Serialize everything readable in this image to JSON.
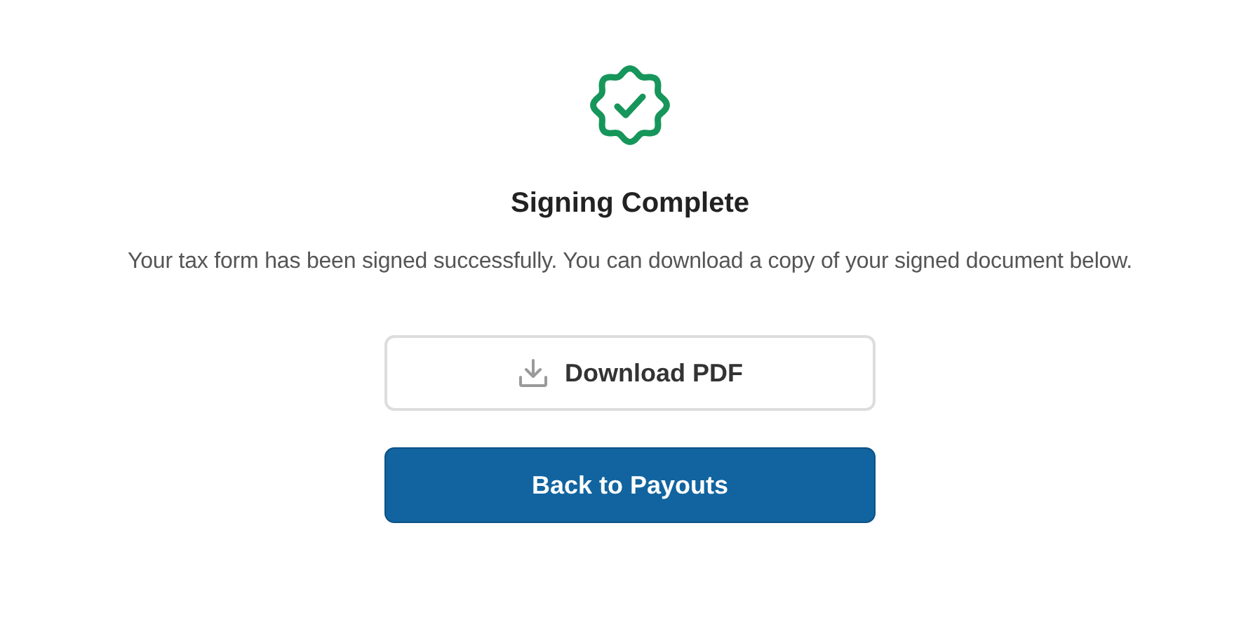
{
  "title": "Signing Complete",
  "message": "Your tax form has been signed successfully. You can download a copy of your signed document below.",
  "buttons": [
    {
      "label": "Download PDF",
      "kind": "outline"
    },
    {
      "label": "Back to Payouts",
      "kind": "primary"
    }
  ]
}
